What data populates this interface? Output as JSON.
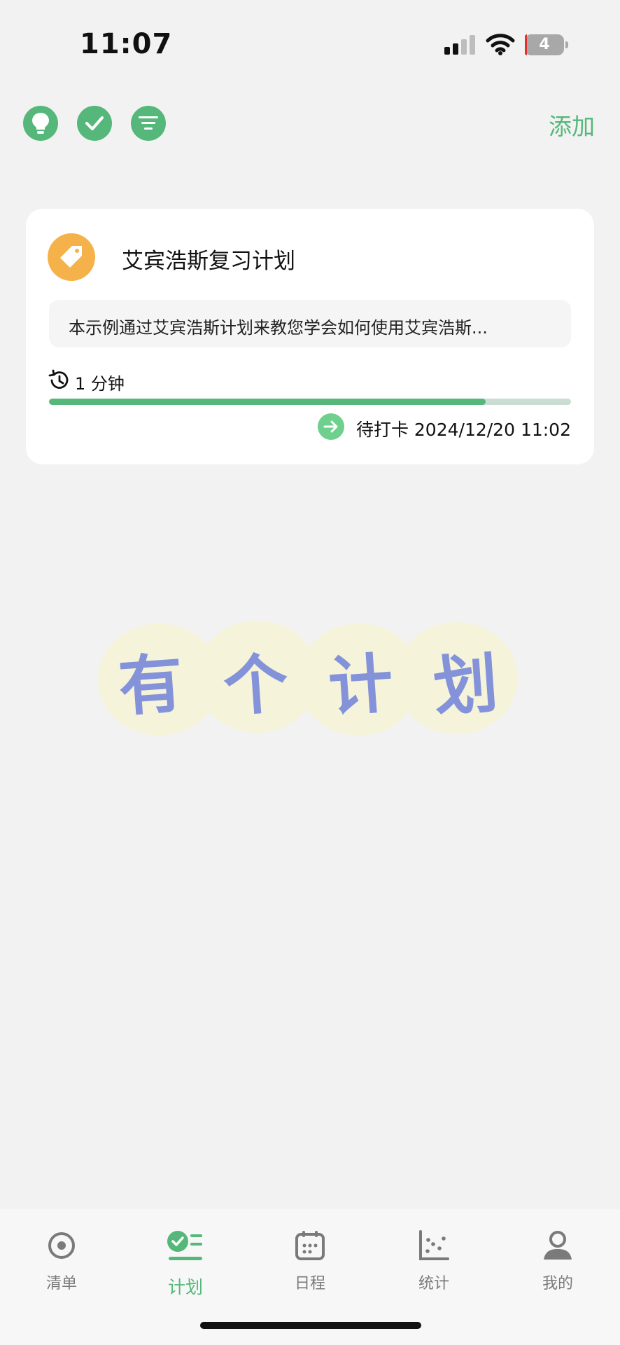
{
  "status_bar": {
    "time": "11:07",
    "battery": "4"
  },
  "toolbar": {
    "add_label": "添加",
    "icons": [
      "bulb-icon",
      "check-icon",
      "filter-icon"
    ]
  },
  "plan": {
    "title": "艾宾浩斯复习计划",
    "description": "本示例通过艾宾浩斯计划来教您学会如何使用艾宾浩斯...",
    "duration": "1 分钟",
    "progress": 0.836,
    "checkin": "待打卡 2024/12/20 11:02",
    "colors": {
      "accent": "#55b87a",
      "badge": "#f6b24a"
    }
  },
  "decoration": {
    "chars": [
      "有",
      "个",
      "计",
      "划"
    ],
    "color": "#8493d9"
  },
  "tabs": [
    {
      "label": "清单",
      "icon": "target-icon",
      "active": false
    },
    {
      "label": "计划",
      "icon": "plan-checklist-icon",
      "active": true
    },
    {
      "label": "日程",
      "icon": "calendar-icon",
      "active": false
    },
    {
      "label": "统计",
      "icon": "scatter-chart-icon",
      "active": false
    },
    {
      "label": "我的",
      "icon": "person-icon",
      "active": false
    }
  ]
}
